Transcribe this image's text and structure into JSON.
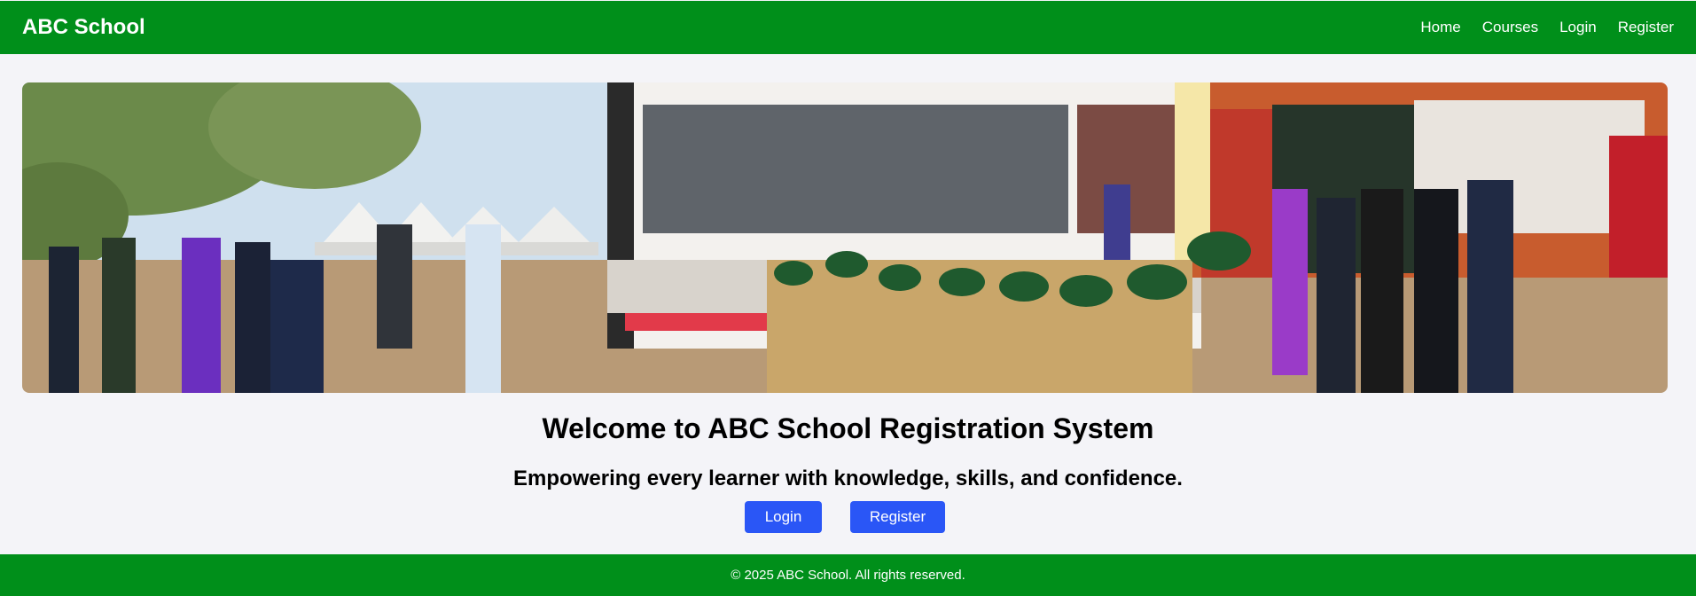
{
  "nav": {
    "brand": "ABC School",
    "links": [
      "Home",
      "Courses",
      "Login",
      "Register"
    ]
  },
  "hero": {
    "welcome": "Welcome to ABC School Registration System",
    "tagline": "Empowering every learner with knowledge, skills, and confidence.",
    "login_label": "Login",
    "register_label": "Register"
  },
  "footer": {
    "text": "© 2025 ABC School. All rights reserved."
  },
  "colors": {
    "brand_green": "#008f1a",
    "button_blue": "#2a56f6",
    "page_bg": "#f4f4f8"
  }
}
